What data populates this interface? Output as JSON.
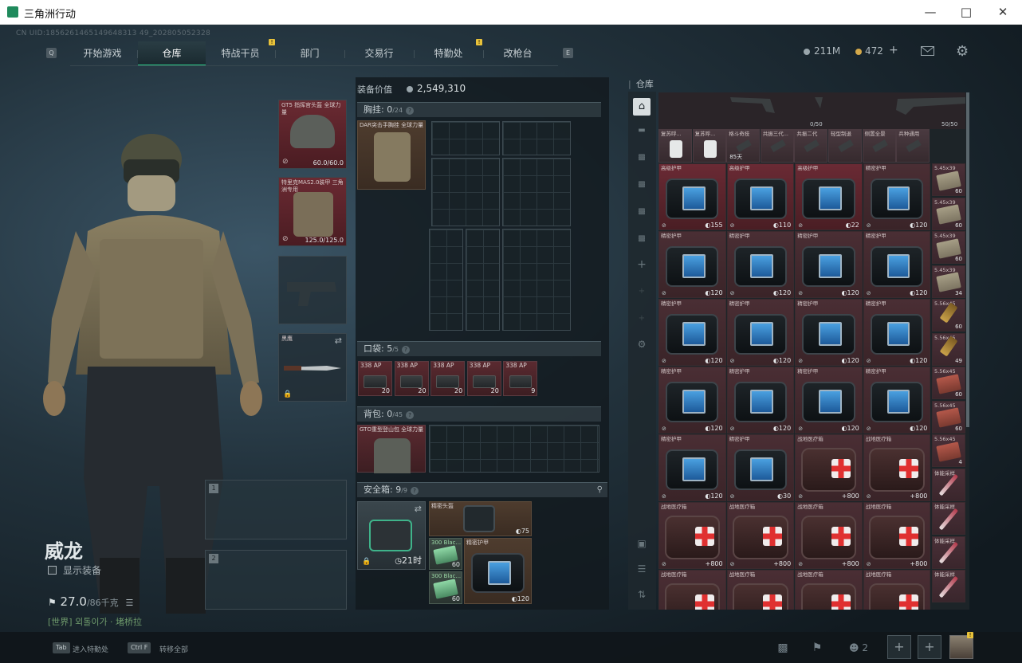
{
  "window": {
    "title": "三角洲行动"
  },
  "uid": "CN UID:1856261465149648313 49_202805052328",
  "nav": {
    "tabs": [
      {
        "label": "开始游戏",
        "selected": false
      },
      {
        "label": "仓库",
        "selected": true
      },
      {
        "label": "特战干员",
        "selected": false,
        "badge": "!"
      },
      {
        "label": "部门",
        "selected": false
      },
      {
        "label": "交易行",
        "selected": false
      },
      {
        "label": "特勤处",
        "selected": false,
        "badge": "!"
      },
      {
        "label": "改枪台",
        "selected": false
      }
    ],
    "left_key": "Q",
    "right_key": "E"
  },
  "currency": {
    "silver": "211M",
    "gold": "472",
    "gold_add": "+"
  },
  "character": {
    "name": "威龙",
    "show_equip": "显示装备",
    "weight": "27.0",
    "weight_max": "/86千克",
    "chat": "[世界] 외톨이가 · 堵桥拉"
  },
  "equip_slots": {
    "helmet": {
      "label": "GT5 指挥官头盔 全球力量",
      "durability": "60.0/60.0"
    },
    "armor": {
      "label": "特里克MAS2.0装甲 三角洲专用",
      "durability": "125.0/125.0"
    },
    "melee": {
      "label": "黑鹰"
    },
    "weapon1": {
      "number": "1"
    },
    "weapon2": {
      "number": "2"
    }
  },
  "loadout": {
    "value_label": "装备价值",
    "value": "2,549,310",
    "chest": {
      "label": "胸挂:",
      "count": "0",
      "max": "/24",
      "item": "DAR突击手胸挂 全球力量"
    },
    "pocket": {
      "label": "口袋:",
      "count": "5",
      "max": "/5",
      "items": [
        {
          "name": "338 AP",
          "count": "20"
        },
        {
          "name": "338 AP",
          "count": "20"
        },
        {
          "name": "338 AP",
          "count": "20"
        },
        {
          "name": "338 AP",
          "count": "20"
        },
        {
          "name": "338 AP",
          "count": "9"
        }
      ]
    },
    "backpack": {
      "label": "背包:",
      "count": "0",
      "max": "/45",
      "item": "GTO重型登山包 全球力量"
    },
    "safe": {
      "label": "安全箱:",
      "count": "9",
      "max": "/9",
      "timer": "21时",
      "items": [
        {
          "name": "精密头盔",
          "value": "75"
        },
        {
          "name": "300 Blac...",
          "count": "60"
        },
        {
          "name": "300 Blac...",
          "count": "60"
        },
        {
          "name": "精密护甲",
          "value": "120"
        }
      ]
    }
  },
  "warehouse": {
    "label": "仓库",
    "top_row": {
      "left_count": "0/50",
      "right_count": "50/50"
    },
    "small_row": [
      {
        "name": "复苏呼..."
      },
      {
        "name": "复苏呼..."
      },
      {
        "name": "格斗奇技",
        "value": "85天"
      },
      {
        "name": "共振三代..."
      },
      {
        "name": "共振二代"
      },
      {
        "name": "轻型制退"
      },
      {
        "name": "侧置全景"
      },
      {
        "name": "兵种通用"
      }
    ],
    "rows": [
      [
        {
          "name": "高级护甲",
          "value": "155",
          "type": "bag"
        },
        {
          "name": "高级护甲",
          "value": "110",
          "type": "bag"
        },
        {
          "name": "高级护甲",
          "value": "22",
          "type": "bag"
        },
        {
          "name": "精密护甲",
          "value": "120",
          "type": "bag"
        }
      ],
      [
        {
          "name": "精密护甲",
          "value": "120",
          "type": "bag"
        },
        {
          "name": "精密护甲",
          "value": "120",
          "type": "bag"
        },
        {
          "name": "精密护甲",
          "value": "120",
          "type": "bag"
        },
        {
          "name": "精密护甲",
          "value": "120",
          "type": "bag"
        }
      ],
      [
        {
          "name": "精密护甲",
          "value": "120",
          "type": "bag"
        },
        {
          "name": "精密护甲",
          "value": "120",
          "type": "bag"
        },
        {
          "name": "精密护甲",
          "value": "120",
          "type": "bag"
        },
        {
          "name": "精密护甲",
          "value": "120",
          "type": "bag"
        }
      ],
      [
        {
          "name": "精密护甲",
          "value": "120",
          "type": "bag"
        },
        {
          "name": "精密护甲",
          "value": "120",
          "type": "bag"
        },
        {
          "name": "精密护甲",
          "value": "120",
          "type": "bag"
        },
        {
          "name": "精密护甲",
          "value": "120",
          "type": "bag"
        }
      ],
      [
        {
          "name": "精密护甲",
          "value": "120",
          "type": "bag"
        },
        {
          "name": "精密护甲",
          "value": "30",
          "type": "bag"
        },
        {
          "name": "战地医疗箱",
          "value": "+800",
          "type": "med"
        },
        {
          "name": "战地医疗箱",
          "value": "+800",
          "type": "med"
        }
      ],
      [
        {
          "name": "战地医疗箱",
          "value": "+800",
          "type": "med"
        },
        {
          "name": "战地医疗箱",
          "value": "+800",
          "type": "med"
        },
        {
          "name": "战地医疗箱",
          "value": "+800",
          "type": "med"
        },
        {
          "name": "战地医疗箱",
          "value": "+800",
          "type": "med"
        }
      ],
      [
        {
          "name": "战地医疗箱",
          "value": "",
          "type": "med"
        },
        {
          "name": "战地医疗箱",
          "value": "",
          "type": "med"
        },
        {
          "name": "战地医疗箱",
          "value": "",
          "type": "med"
        },
        {
          "name": "战地医疗箱",
          "value": "",
          "type": "med"
        }
      ]
    ],
    "ammo_column": [
      {
        "name": "5.45x39",
        "count": "60",
        "type": "plain"
      },
      {
        "name": "5.45x39",
        "count": "60",
        "type": "plain"
      },
      {
        "name": "5.45x39",
        "count": "60",
        "type": "plain"
      },
      {
        "name": "5.45x39",
        "count": "34",
        "type": "plain"
      },
      {
        "name": "5.56x45",
        "count": "60",
        "type": "brass"
      },
      {
        "name": "5.56x45",
        "count": "49",
        "type": "brass"
      },
      {
        "name": "5.56x45",
        "count": "60",
        "type": "red"
      },
      {
        "name": "5.56x45",
        "count": "60",
        "type": "red"
      },
      {
        "name": "5.56x45",
        "count": "4",
        "type": "red"
      },
      {
        "name": "体能采样",
        "count": "",
        "type": "pen"
      },
      {
        "name": "体能采样",
        "count": "",
        "type": "pen"
      },
      {
        "name": "体能采样",
        "count": "",
        "type": "pen"
      },
      {
        "name": "体能采样",
        "count": "",
        "type": "pen"
      }
    ]
  },
  "bottom": {
    "tab_key": "Tab",
    "tab_label": "进入特勤处",
    "ctrl_key": "Ctrl F",
    "ctrl_label": "转移全部",
    "friends_count": "2"
  }
}
